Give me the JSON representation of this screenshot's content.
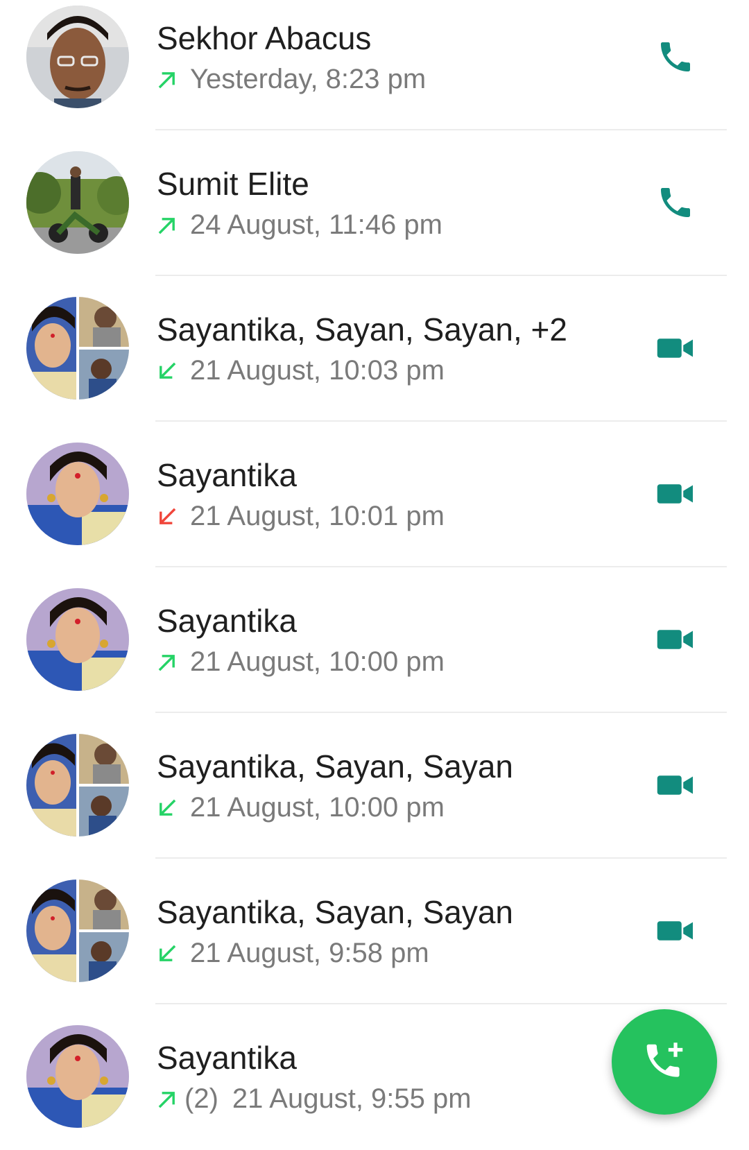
{
  "colors": {
    "accent_teal": "#128C7E",
    "outgoing_green": "#25D366",
    "missed_red": "#F0453A",
    "fab_green": "#25C25E"
  },
  "calls": [
    {
      "name": "Sekhor Abacus",
      "direction": "outgoing",
      "direction_icon": "outgoing-arrow-icon",
      "count": "",
      "time": "Yesterday, 8:23 pm",
      "call_type": "voice",
      "action_icon": "phone-icon",
      "avatar": "single"
    },
    {
      "name": "Sumit Elite",
      "direction": "outgoing",
      "direction_icon": "outgoing-arrow-icon",
      "count": "",
      "time": "24 August, 11:46 pm",
      "call_type": "voice",
      "action_icon": "phone-icon",
      "avatar": "single"
    },
    {
      "name": "Sayantika, Sayan, Sayan, +2",
      "direction": "incoming",
      "direction_icon": "incoming-arrow-icon",
      "count": "",
      "time": "21 August, 10:03 pm",
      "call_type": "video",
      "action_icon": "video-camera-icon",
      "avatar": "group"
    },
    {
      "name": "Sayantika",
      "direction": "missed",
      "direction_icon": "missed-arrow-icon",
      "count": "",
      "time": "21 August, 10:01 pm",
      "call_type": "video",
      "action_icon": "video-camera-icon",
      "avatar": "single"
    },
    {
      "name": "Sayantika",
      "direction": "outgoing",
      "direction_icon": "outgoing-arrow-icon",
      "count": "",
      "time": "21 August, 10:00 pm",
      "call_type": "video",
      "action_icon": "video-camera-icon",
      "avatar": "single"
    },
    {
      "name": "Sayantika, Sayan, Sayan",
      "direction": "incoming",
      "direction_icon": "incoming-arrow-icon",
      "count": "",
      "time": "21 August, 10:00 pm",
      "call_type": "video",
      "action_icon": "video-camera-icon",
      "avatar": "group"
    },
    {
      "name": "Sayantika, Sayan, Sayan",
      "direction": "incoming",
      "direction_icon": "incoming-arrow-icon",
      "count": "",
      "time": "21 August, 9:58 pm",
      "call_type": "video",
      "action_icon": "video-camera-icon",
      "avatar": "group"
    },
    {
      "name": "Sayantika",
      "direction": "outgoing",
      "direction_icon": "outgoing-arrow-icon",
      "count": "(2)",
      "time": "21 August, 9:55 pm",
      "call_type": "video",
      "action_icon": "video-camera-icon",
      "avatar": "single"
    }
  ],
  "fab": {
    "icon": "add-call-icon"
  }
}
